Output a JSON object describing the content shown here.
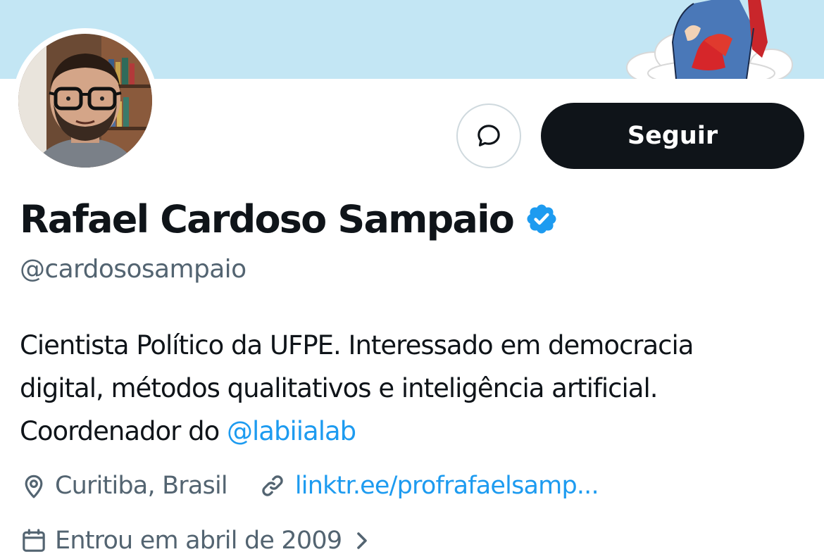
{
  "profile": {
    "display_name": "Rafael Cardoso Sampaio",
    "handle": "@cardososampaio",
    "verified_icon": "verified-badge-icon",
    "bio": {
      "line1": "Cientista Político da UFPE. Interessado em democracia",
      "line2": "digital, métodos qualitativos e inteligência artificial.",
      "line3_prefix": "Coordenador do ",
      "mention": "@labiialab"
    },
    "location": "Curitiba, Brasil",
    "website": "linktr.ee/profrafaelsamp...",
    "joined": "Entrou em abril de 2009"
  },
  "actions": {
    "follow_label": "Seguir",
    "message_icon": "message-bubble-icon"
  },
  "colors": {
    "primary_text": "#0f1419",
    "secondary_text": "#536471",
    "link": "#1d9bf0",
    "banner_sky": "#c3e6f4",
    "button_dark": "#0f1419"
  }
}
